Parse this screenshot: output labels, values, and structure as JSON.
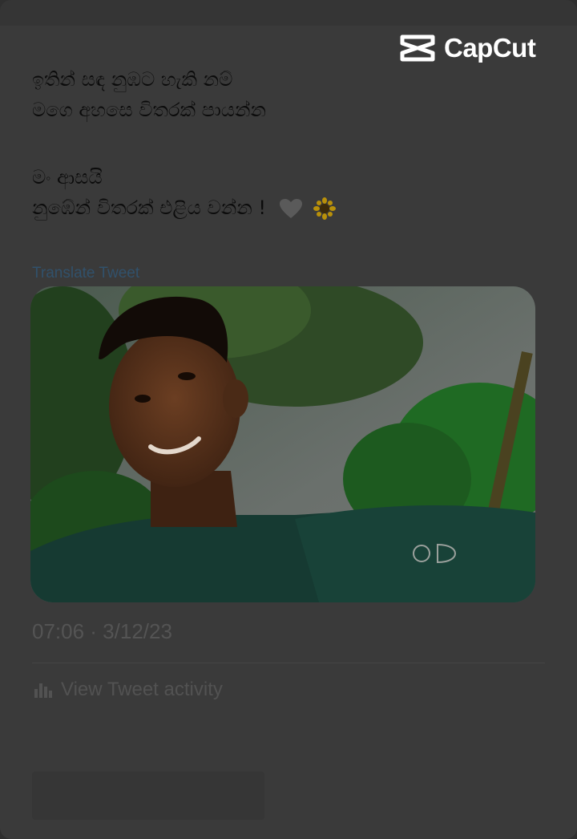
{
  "watermark": {
    "brand": "CapCut",
    "icon": "capcut-logo-icon"
  },
  "tweet": {
    "lines": [
      "ඉතින් සඳ නුඹට හැකි නම්",
      "මගෙ අහසෙ විතරක් පායන්න",
      "මං ආසයි",
      "නුඹේන් විතරක් එළිය වන්න !"
    ],
    "emoji": [
      "white-heart-icon",
      "sunflower-icon"
    ],
    "translate_label": "Translate Tweet",
    "timestamp": "07:06 · 3/12/23",
    "activity_label": "View Tweet activity",
    "activity_icon": "bar-chart-icon"
  },
  "colors": {
    "background": "#3a3a3a",
    "link": "#31516b",
    "muted": "#545454"
  }
}
